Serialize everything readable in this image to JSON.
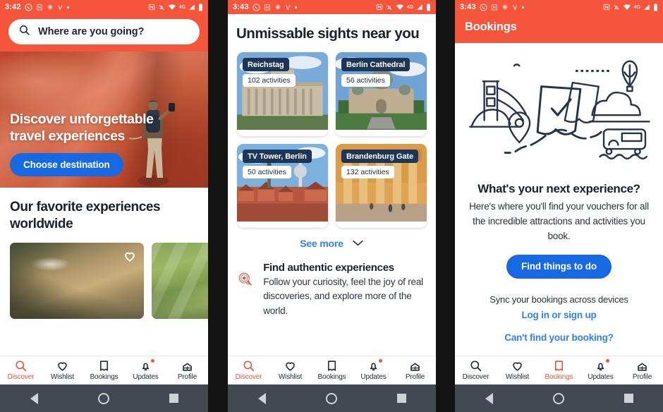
{
  "theme": {
    "brand_orange": "#F4553B",
    "brand_blue": "#1668E3",
    "link_blue": "#2f7ff0",
    "navy": "#1D3557",
    "text_dark": "#18212E"
  },
  "panel1": {
    "status": {
      "time": "3:42",
      "network": "4G"
    },
    "search": {
      "placeholder": "Where are you going?",
      "icon": "search-icon"
    },
    "hero": {
      "headline": "Discover unforgettable travel experiences",
      "cta": "Choose destination"
    },
    "favorites": {
      "heading": "Our favorite experiences worldwide"
    },
    "tabs": [
      {
        "label": "Discover",
        "icon": "search-icon",
        "active": true,
        "badge": false
      },
      {
        "label": "Wishlist",
        "icon": "heart-icon",
        "active": false,
        "badge": false
      },
      {
        "label": "Bookings",
        "icon": "ticket-icon",
        "active": false,
        "badge": false
      },
      {
        "label": "Updates",
        "icon": "bell-icon",
        "active": false,
        "badge": true
      },
      {
        "label": "Profile",
        "icon": "profile-icon",
        "active": false,
        "badge": false
      }
    ]
  },
  "panel2": {
    "status": {
      "time": "3:43",
      "network": "4G"
    },
    "heading": "Unmissable sights near you",
    "sights": [
      {
        "name": "Reichstag",
        "activities": "102 activities"
      },
      {
        "name": "Berlin Cathedral",
        "activities": "56 activities"
      },
      {
        "name": "TV Tower, Berlin",
        "activities": "50 activities"
      },
      {
        "name": "Brandenburg Gate",
        "activities": "132 activities"
      }
    ],
    "see_more": "See more",
    "authentic": {
      "icon": "magnifier-sparkle-icon",
      "title": "Find authentic experiences",
      "body": "Follow your curiosity, feel the joy of real discoveries, and explore more of the world."
    },
    "tabs": [
      {
        "label": "Discover",
        "icon": "search-icon",
        "active": true,
        "badge": false
      },
      {
        "label": "Wishlist",
        "icon": "heart-icon",
        "active": false,
        "badge": false
      },
      {
        "label": "Bookings",
        "icon": "ticket-icon",
        "active": false,
        "badge": false
      },
      {
        "label": "Updates",
        "icon": "bell-icon",
        "active": false,
        "badge": true
      },
      {
        "label": "Profile",
        "icon": "profile-icon",
        "active": false,
        "badge": false
      }
    ]
  },
  "panel3": {
    "status": {
      "time": "3:43",
      "network": "4G"
    },
    "title": "Bookings",
    "illustration": "travel-vouchers-illustration",
    "empty_title": "What's your next experience?",
    "empty_body": "Here's where you'll find your vouchers for all the incredible attractions and activities you book.",
    "cta": "Find things to do",
    "sync_text": "Sync your bookings across devices",
    "login_link": "Log in or sign up",
    "help_link": "Can't find your booking?",
    "tabs": [
      {
        "label": "Discover",
        "icon": "search-icon",
        "active": false,
        "badge": false
      },
      {
        "label": "Wishlist",
        "icon": "heart-icon",
        "active": false,
        "badge": false
      },
      {
        "label": "Bookings",
        "icon": "ticket-icon",
        "active": true,
        "badge": false
      },
      {
        "label": "Updates",
        "icon": "bell-icon",
        "active": false,
        "badge": true
      },
      {
        "label": "Profile",
        "icon": "profile-icon",
        "active": false,
        "badge": false
      }
    ]
  },
  "system_nav": {
    "back": "back-button",
    "home": "home-button",
    "recents": "recents-button"
  }
}
